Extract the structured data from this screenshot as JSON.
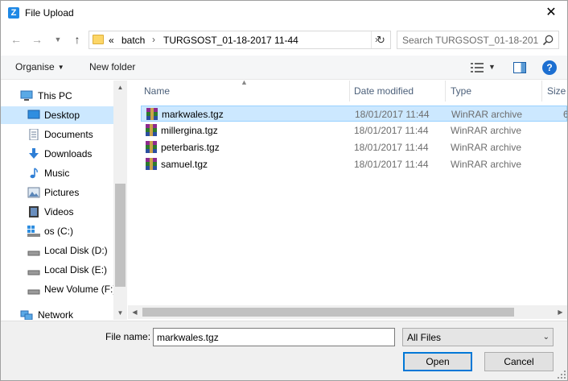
{
  "window": {
    "title": "File Upload",
    "app_icon_letter": "Z",
    "close_glyph": "✕"
  },
  "nav": {
    "back_glyph": "←",
    "forward_glyph": "→",
    "recent_glyph": "▼",
    "up_glyph": "↑",
    "breadcrumbs": [
      "batch",
      "TURGSOST_01-18-2017 11-44"
    ],
    "overflow_glyph": "«",
    "separator_glyph": "›",
    "refresh_glyph": "↻",
    "search_placeholder": "Search TURGSOST_01-18-201..."
  },
  "toolbar": {
    "organise_label": "Organise",
    "new_folder_label": "New folder",
    "help_glyph": "?"
  },
  "sidebar": {
    "items": [
      {
        "label": "This PC",
        "icon": "pc-icon"
      },
      {
        "label": "Desktop",
        "icon": "desktop-icon"
      },
      {
        "label": "Documents",
        "icon": "documents-icon"
      },
      {
        "label": "Downloads",
        "icon": "downloads-icon"
      },
      {
        "label": "Music",
        "icon": "music-icon"
      },
      {
        "label": "Pictures",
        "icon": "pictures-icon"
      },
      {
        "label": "Videos",
        "icon": "videos-icon"
      },
      {
        "label": "os (C:)",
        "icon": "drive-icon"
      },
      {
        "label": "Local Disk (D:)",
        "icon": "drive-icon"
      },
      {
        "label": "Local Disk (E:)",
        "icon": "drive-icon"
      },
      {
        "label": "New Volume (F:)",
        "icon": "drive-icon"
      },
      {
        "label": "Network",
        "icon": "network-icon"
      }
    ],
    "selected": "Desktop"
  },
  "filelist": {
    "columns": {
      "name": "Name",
      "date": "Date modified",
      "type": "Type",
      "size": "Size"
    },
    "rows": [
      {
        "name": "markwales.tgz",
        "date": "18/01/2017 11:44",
        "type": "WinRAR archive",
        "size": "6"
      },
      {
        "name": "millergina.tgz",
        "date": "18/01/2017 11:44",
        "type": "WinRAR archive",
        "size": ""
      },
      {
        "name": "peterbaris.tgz",
        "date": "18/01/2017 11:44",
        "type": "WinRAR archive",
        "size": ""
      },
      {
        "name": "samuel.tgz",
        "date": "18/01/2017 11:44",
        "type": "WinRAR archive",
        "size": ""
      }
    ],
    "selected_index": 0,
    "accent": "#cce8ff"
  },
  "bottom": {
    "file_name_label": "File name:",
    "file_name_value": "markwales.tgz",
    "filter_value": "All Files",
    "open_label": "Open",
    "cancel_label": "Cancel"
  }
}
